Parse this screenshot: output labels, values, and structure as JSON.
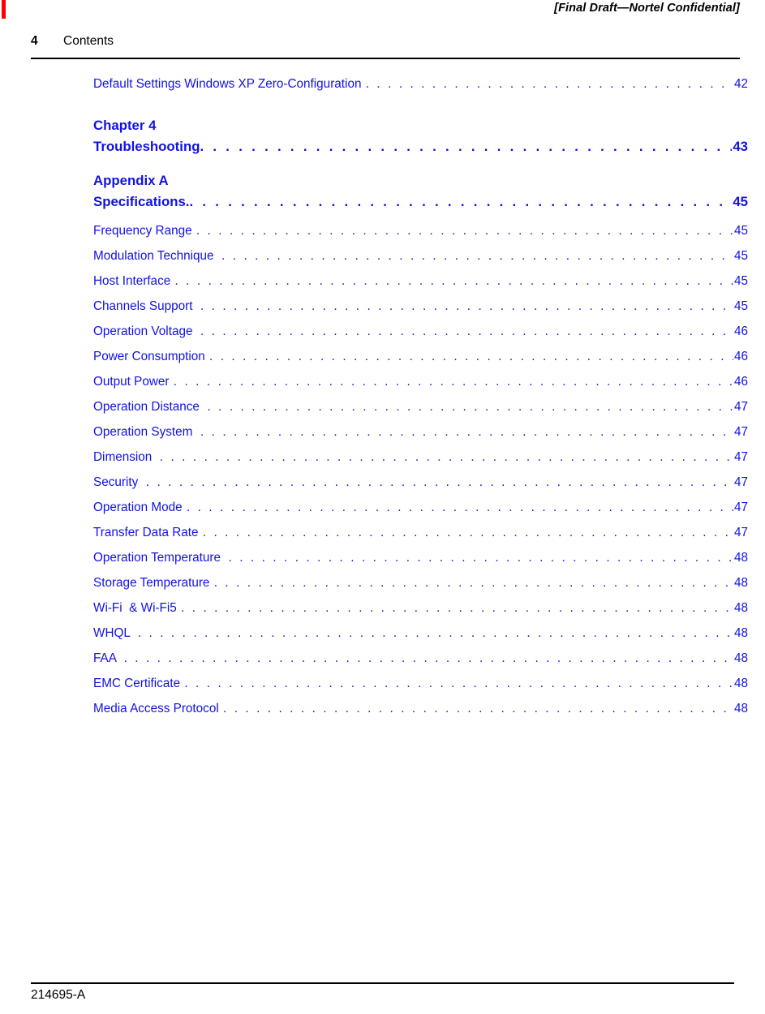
{
  "page": {
    "folio": "4",
    "running_title": "Contents",
    "header_note": "[Final Draft—Nortel Confidential]",
    "footer_id": "214695-A",
    "accent_color": "#1212e2",
    "change_bar_color": "#ff0000"
  },
  "toc": {
    "lead_entries": [
      {
        "label": "Default Settings Windows XP Zero-Configuration ",
        "page": "42"
      }
    ],
    "groups": [
      {
        "heading": "Chapter 4",
        "title": "Troubleshooting",
        "page": "43"
      },
      {
        "heading": "Appendix A",
        "title": "Specifications.",
        "page": "45"
      }
    ],
    "entries": [
      {
        "label": "Frequency Range ",
        "page": "45"
      },
      {
        "label": "Modulation Technique  ",
        "page": "45"
      },
      {
        "label": "Host Interface ",
        "page": "45"
      },
      {
        "label": "Channels Support  ",
        "page": "45"
      },
      {
        "label": "Operation Voltage  ",
        "page": "46"
      },
      {
        "label": "Power Consumption ",
        "page": "46"
      },
      {
        "label": "Output Power ",
        "page": "46"
      },
      {
        "label": "Operation Distance  ",
        "page": "47"
      },
      {
        "label": "Operation System  ",
        "page": "47"
      },
      {
        "label": "Dimension  ",
        "page": "47"
      },
      {
        "label": "Security  ",
        "page": "47"
      },
      {
        "label": "Operation Mode ",
        "page": "47"
      },
      {
        "label": "Transfer Data Rate ",
        "page": "47"
      },
      {
        "label": "Operation Temperature  ",
        "page": "48"
      },
      {
        "label": "Storage Temperature ",
        "page": "48"
      },
      {
        "label": "Wi-Fi  & Wi-Fi5 ",
        "page": "48"
      },
      {
        "label": "WHQL  ",
        "page": "48"
      },
      {
        "label": "FAA  ",
        "page": "48"
      },
      {
        "label": "EMC Certificate ",
        "page": "48"
      },
      {
        "label": "Media Access Protocol ",
        "page": "48"
      }
    ]
  }
}
